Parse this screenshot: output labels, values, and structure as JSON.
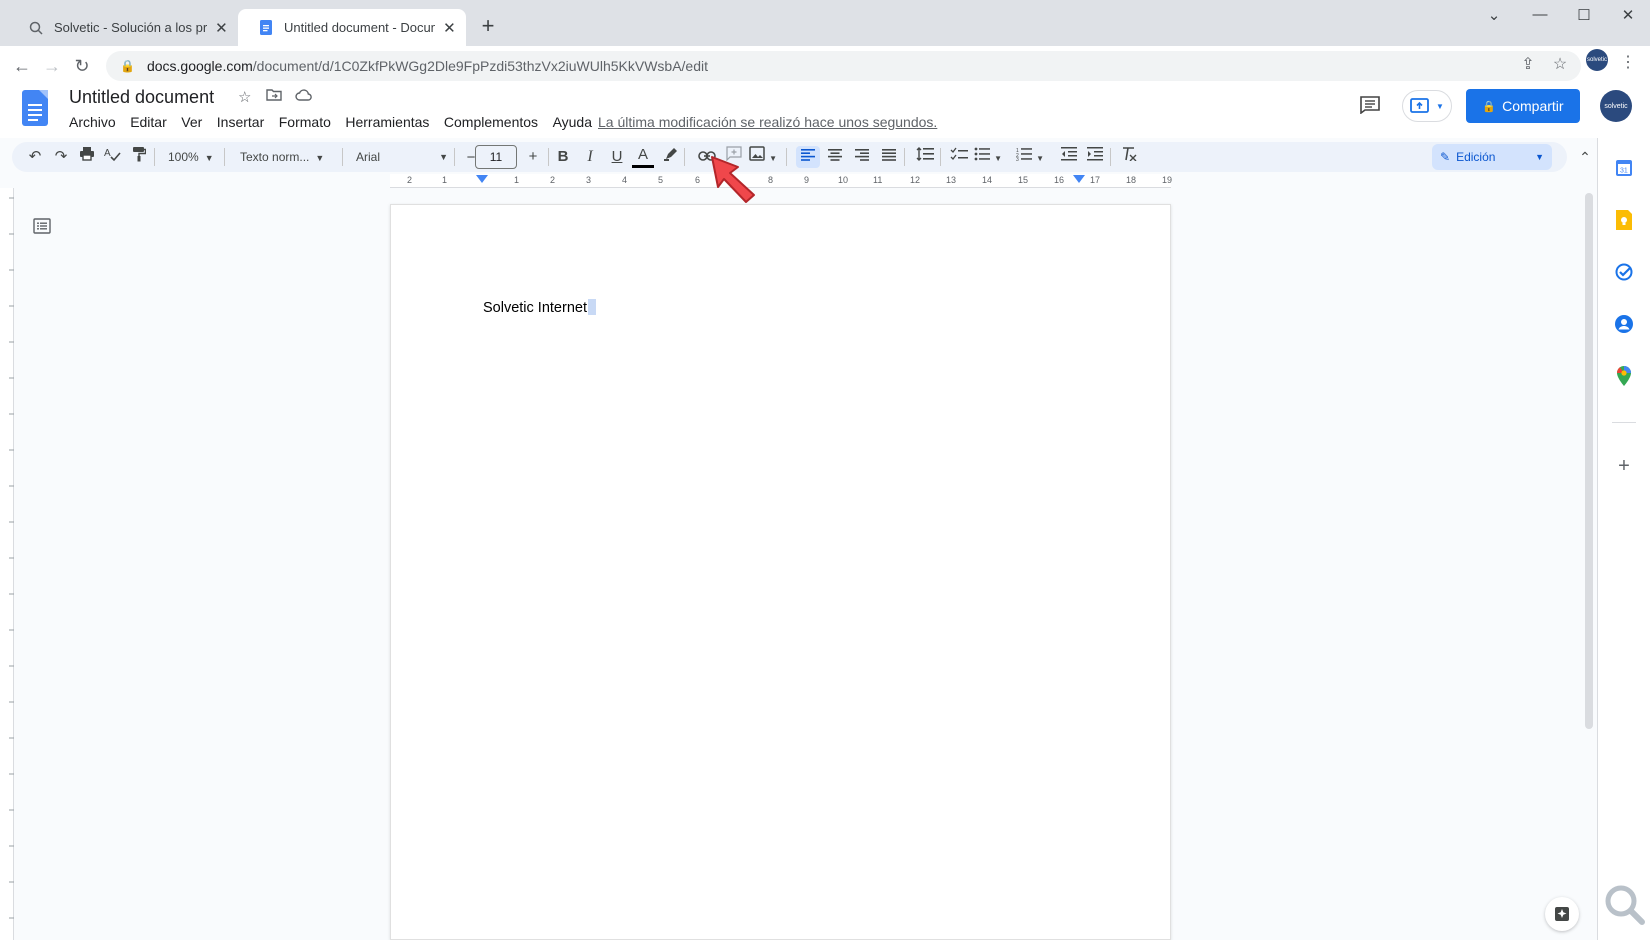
{
  "browser": {
    "tabs": [
      {
        "title": "Solvetic - Solución a los problem",
        "close": "✕"
      },
      {
        "title": "Untitled document - Documento",
        "close": "✕"
      }
    ],
    "new_tab": "+",
    "window_controls": {
      "chevron": "⌄",
      "minimize": "—",
      "maximize": "☐",
      "close": "✕"
    },
    "url_host": "docs.google.com",
    "url_path": "/document/d/1C0ZkfPkWGg2Dle9FpPzdi53thzVx2iuWUlh5KkVWsbA/edit",
    "profile_label": "solvetic"
  },
  "docs": {
    "title": "Untitled document",
    "menus": [
      "Archivo",
      "Editar",
      "Ver",
      "Insertar",
      "Formato",
      "Herramientas",
      "Complementos",
      "Ayuda"
    ],
    "last_edit": "La última modificación se realizó hace unos segundos.",
    "share_label": "Compartir",
    "avatar_label": "solvetic"
  },
  "format_toolbar": {
    "zoom": "100%",
    "style": "Texto norm...",
    "font": "Arial",
    "font_size": "11",
    "decrease": "−",
    "increase": "+",
    "bold": "B",
    "italic": "I",
    "underline": "U",
    "text_color": "A",
    "mode": "Edición"
  },
  "ruler": {
    "numbers": [
      "2",
      "1",
      "1",
      "2",
      "3",
      "4",
      "5",
      "6",
      "7",
      "8",
      "9",
      "10",
      "11",
      "12",
      "13",
      "14",
      "15",
      "16",
      "17",
      "18",
      "19"
    ]
  },
  "document": {
    "body_text": "Solvetic Internet"
  },
  "colors": {
    "accent": "#1a73e8",
    "docs_blue": "#4285f4",
    "toolbar_bg": "#edf2fa",
    "pointer_red": "#f0474b"
  }
}
